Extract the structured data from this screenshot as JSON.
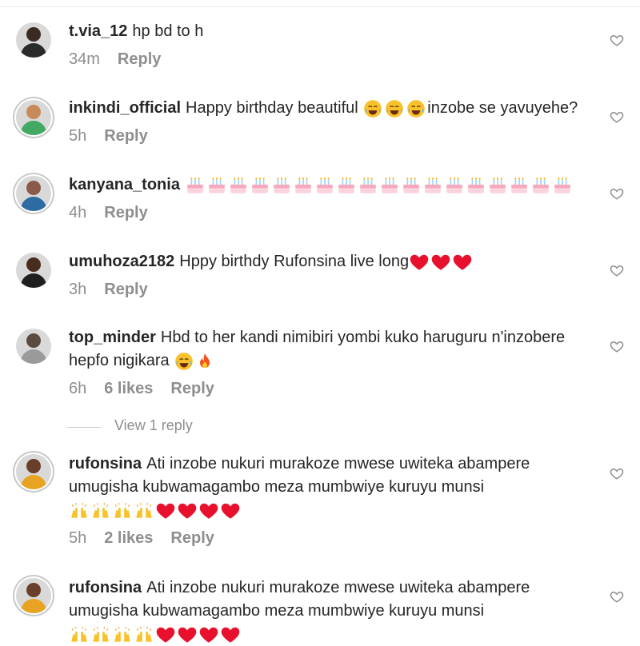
{
  "comments": [
    {
      "username": "t.via_12",
      "text": "hp bd to h",
      "time": "34m",
      "likes": "",
      "reply": "Reply"
    },
    {
      "username": "inkindi_official",
      "text": "Happy birthday beautiful",
      "text_after": "inzobe se yavuyehe?",
      "time": "5h",
      "likes": "",
      "reply": "Reply"
    },
    {
      "username": "kanyana_tonia",
      "text": "",
      "time": "4h",
      "likes": "",
      "reply": "Reply"
    },
    {
      "username": "umuhoza2182",
      "text": "Hppy birthdy Rufonsina live long",
      "time": "3h",
      "likes": "",
      "reply": "Reply"
    },
    {
      "username": "top_minder",
      "text": "Hbd to her kandi nimibiri yombi kuko haruguru n'inzobere hepfo nigikara",
      "time": "6h",
      "likes": "6 likes",
      "reply": "Reply"
    },
    {
      "username": "rufonsina",
      "text": "Ati inzobe nukuri murakoze mwese uwiteka abampere umugisha kubwamagambo meza mumbwiye kuruyu munsi",
      "time": "5h",
      "likes": "2 likes",
      "reply": "Reply"
    },
    {
      "username": "rufonsina",
      "text": "Ati inzobe nukuri murakoze mwese uwiteka abampere umugisha kubwamagambo meza mumbwiye kuruyu munsi",
      "time": "",
      "likes": "",
      "reply": ""
    }
  ],
  "view_replies": "View 1 reply",
  "icons": {
    "like": "heart-outline-icon",
    "laugh": "face-with-tears-of-joy-icon",
    "cake": "birthday-cake-icon",
    "heart": "red-heart-icon",
    "fire": "fire-icon",
    "hands": "raising-hands-icon"
  },
  "colors": {
    "text": "#262626",
    "meta": "#8e8e8e",
    "red": "#e8112d"
  }
}
